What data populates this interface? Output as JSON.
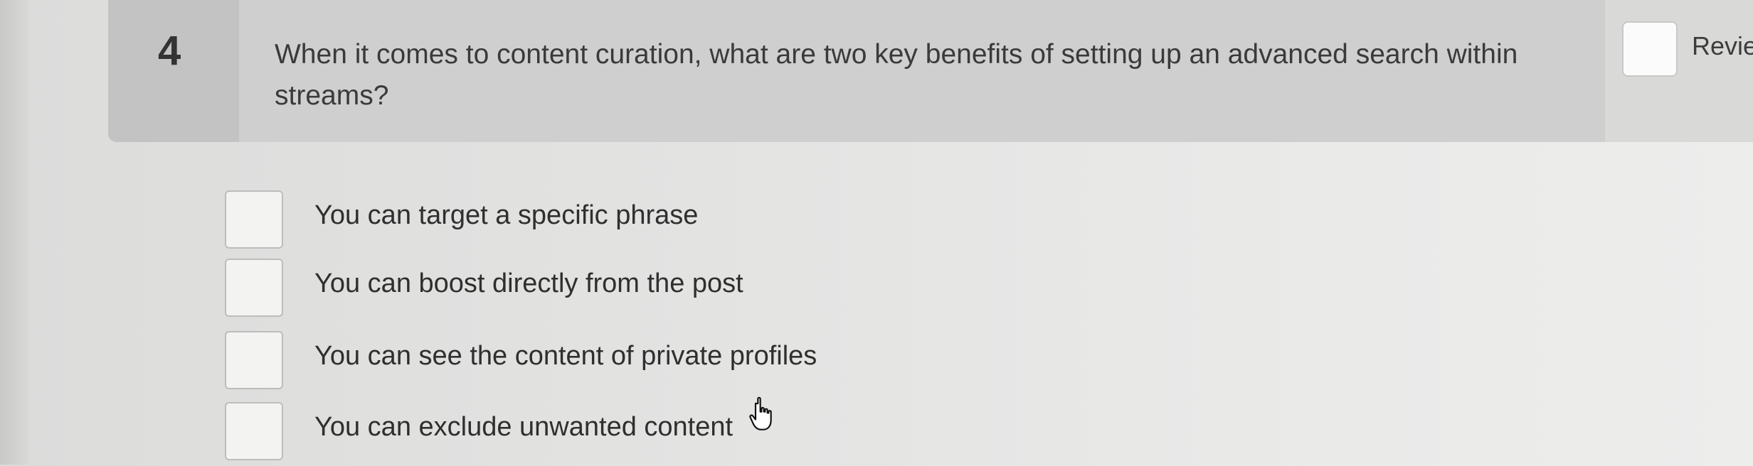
{
  "question": {
    "number": "4",
    "text": "When it comes to content curation, what are two key benefits of setting up an advanced search within streams?"
  },
  "review": {
    "label": "Revie"
  },
  "options": [
    {
      "label": "You can target a specific phrase",
      "checked": false
    },
    {
      "label": "You can boost directly from the post",
      "checked": false
    },
    {
      "label": "You can see the content of private profiles",
      "checked": false
    },
    {
      "label": "You can exclude unwanted content",
      "checked": false
    }
  ],
  "cursor": {
    "icon": "hand-pointer-icon"
  }
}
